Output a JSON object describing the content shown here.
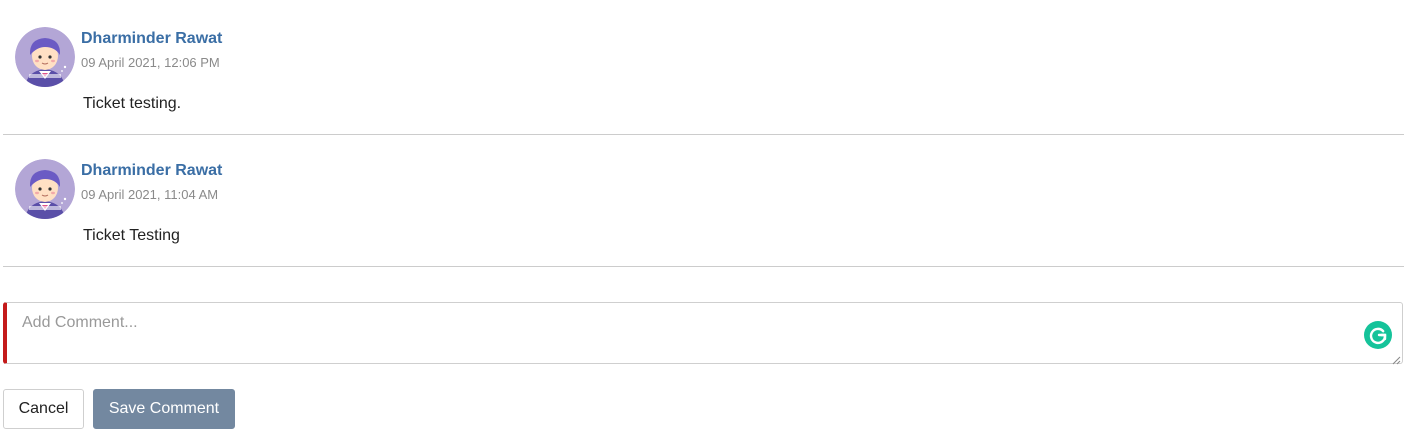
{
  "comments": [
    {
      "author": "Dharminder Rawat",
      "timestamp": "09 April 2021, 12:06 PM",
      "text": "Ticket testing."
    },
    {
      "author": "Dharminder Rawat",
      "timestamp": "09 April 2021, 11:04 AM",
      "text": "Ticket Testing"
    }
  ],
  "comment_input": {
    "placeholder": "Add Comment...",
    "value": ""
  },
  "actions": {
    "cancel_label": "Cancel",
    "save_label": "Save Comment"
  },
  "icons": {
    "avatar": "user-avatar",
    "grammarly": "grammarly-icon",
    "resize": "resize-handle-icon"
  },
  "colors": {
    "author": "#3a6ea5",
    "timestamp": "#8a8a8a",
    "input_accent": "#c41a1a",
    "save_button": "#7388a0",
    "grammarly": "#15c39a"
  }
}
